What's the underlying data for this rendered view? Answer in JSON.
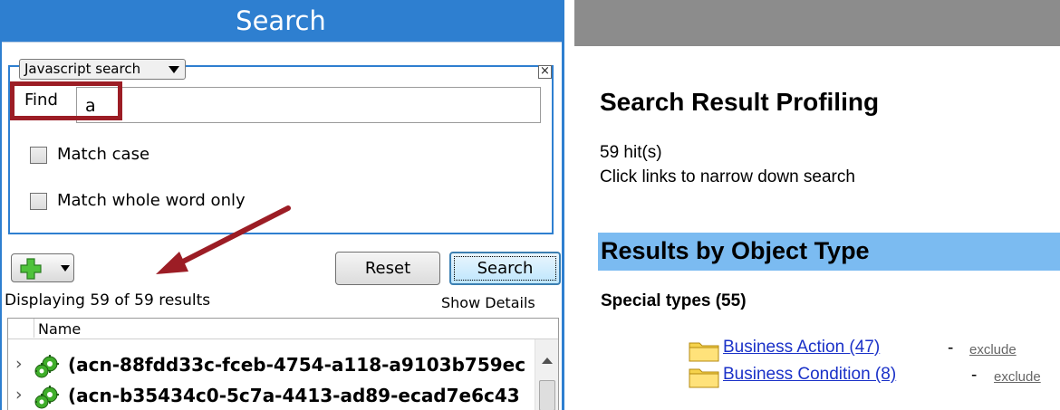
{
  "search_panel": {
    "title": "Search",
    "search_type": "Javascript search",
    "close_glyph": "×",
    "find_label": "Find",
    "find_value": "a",
    "match_case_label": "Match case",
    "match_case_checked": false,
    "match_whole_word_label": "Match whole word only",
    "match_whole_word_checked": false,
    "reset_label": "Reset",
    "search_label": "Search",
    "results_count": "Displaying 59 of 59 results",
    "show_details_label": "Show Details",
    "table": {
      "column_name": "Name",
      "rows": [
        {
          "expand": "›",
          "icon": "gear-icon",
          "text": "(acn-88fdd33c-fceb-4754-a118-a9103b759ec"
        },
        {
          "expand": "›",
          "icon": "gear-icon",
          "text": "(acn-b35434c0-5c7a-4413-ad89-ecad7e6c43"
        }
      ]
    }
  },
  "profiling_panel": {
    "title": "Search Result Profiling",
    "hits": "59 hit(s)",
    "instruction": "Click links to narrow down search",
    "section_title": "Results by Object Type",
    "group_title": "Special types (55)",
    "items": [
      {
        "icon": "folder-icon",
        "label": "Business Action (47)",
        "separator": "-",
        "exclude_label": "exclude"
      },
      {
        "icon": "folder-icon",
        "label": "Business Condition (8)",
        "separator": "-",
        "exclude_label": "exclude"
      }
    ]
  },
  "colors": {
    "header_blue": "#2e7fd0",
    "highlight_red": "#9c1d25",
    "section_bar": "#7bbbf1",
    "link": "#1a31c8",
    "right_header_gray": "#8c8c8c"
  }
}
